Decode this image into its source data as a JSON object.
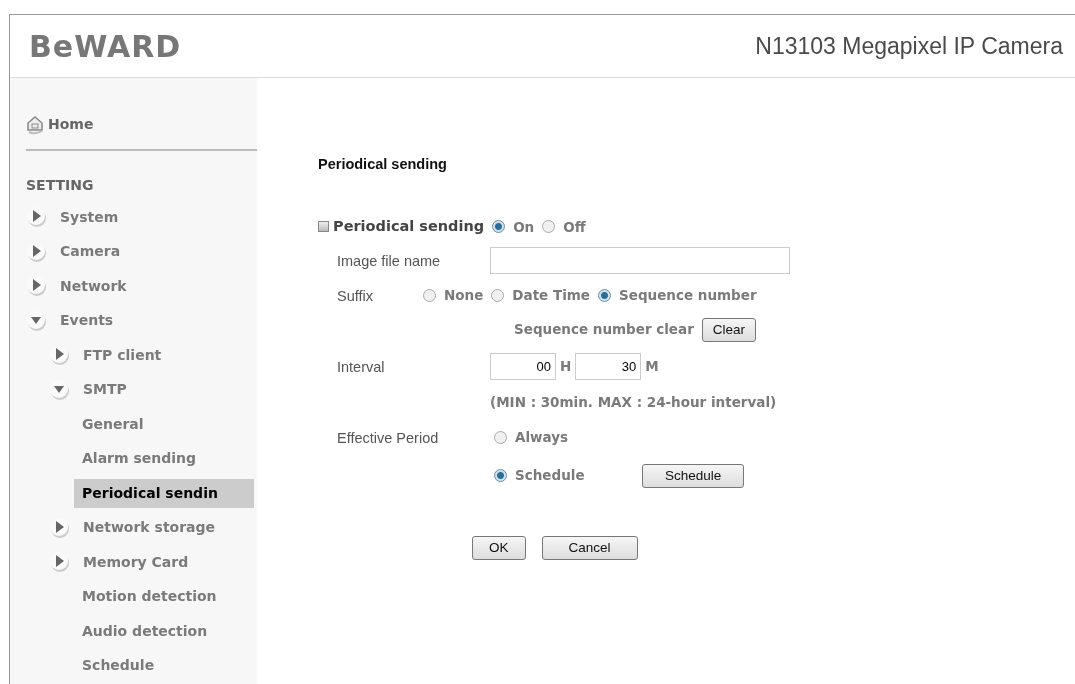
{
  "header": {
    "logo": "BeWARD",
    "title": "N13103 Megapixel IP Camera"
  },
  "sidebar": {
    "home": "Home",
    "section": "SETTING",
    "items": [
      {
        "label": "System",
        "kind": "group",
        "expanded": false,
        "selected": false
      },
      {
        "label": "Camera",
        "kind": "group",
        "expanded": false,
        "selected": false
      },
      {
        "label": "Network",
        "kind": "group",
        "expanded": false,
        "selected": false
      },
      {
        "label": "Events",
        "kind": "group",
        "expanded": true,
        "selected": false,
        "children": [
          {
            "label": "FTP client",
            "kind": "group",
            "expanded": false,
            "selected": false
          },
          {
            "label": "SMTP",
            "kind": "group",
            "expanded": true,
            "selected": false,
            "children": [
              {
                "label": "General",
                "kind": "page",
                "selected": false
              },
              {
                "label": "Alarm sending",
                "kind": "page",
                "selected": false
              },
              {
                "label": "Periodical sendin",
                "kind": "page",
                "selected": true
              }
            ]
          },
          {
            "label": "Network storage",
            "kind": "group",
            "expanded": false,
            "selected": false
          },
          {
            "label": "Memory Card",
            "kind": "group",
            "expanded": false,
            "selected": false
          },
          {
            "label": "Motion detection",
            "kind": "page",
            "selected": false
          },
          {
            "label": "Audio detection",
            "kind": "page",
            "selected": false
          },
          {
            "label": "Schedule",
            "kind": "page",
            "selected": false
          }
        ]
      }
    ]
  },
  "content": {
    "heading": "Periodical sending",
    "enable": {
      "label": "Periodical sending",
      "options": [
        {
          "label": "On",
          "selected": true
        },
        {
          "label": "Off",
          "selected": false
        }
      ]
    },
    "image_file_name": {
      "label": "Image file name"
    },
    "suffix": {
      "label": "Suffix",
      "options": [
        {
          "label": "None",
          "selected": false
        },
        {
          "label": "Date Time",
          "selected": false
        },
        {
          "label": "Sequence number",
          "selected": true
        }
      ],
      "clear_label": "Sequence number clear",
      "clear_button": "Clear"
    },
    "interval": {
      "label": "Interval",
      "hours": "00",
      "hours_unit": "H",
      "minutes": "30",
      "minutes_unit": "M",
      "note": "(MIN : 30min. MAX : 24-hour interval)"
    },
    "effective_period": {
      "label": "Effective Period",
      "options": [
        {
          "label": "Always",
          "selected": false
        },
        {
          "label": "Schedule",
          "selected": true
        }
      ],
      "schedule_button": "Schedule"
    },
    "buttons": [
      "OK",
      "Cancel"
    ]
  }
}
